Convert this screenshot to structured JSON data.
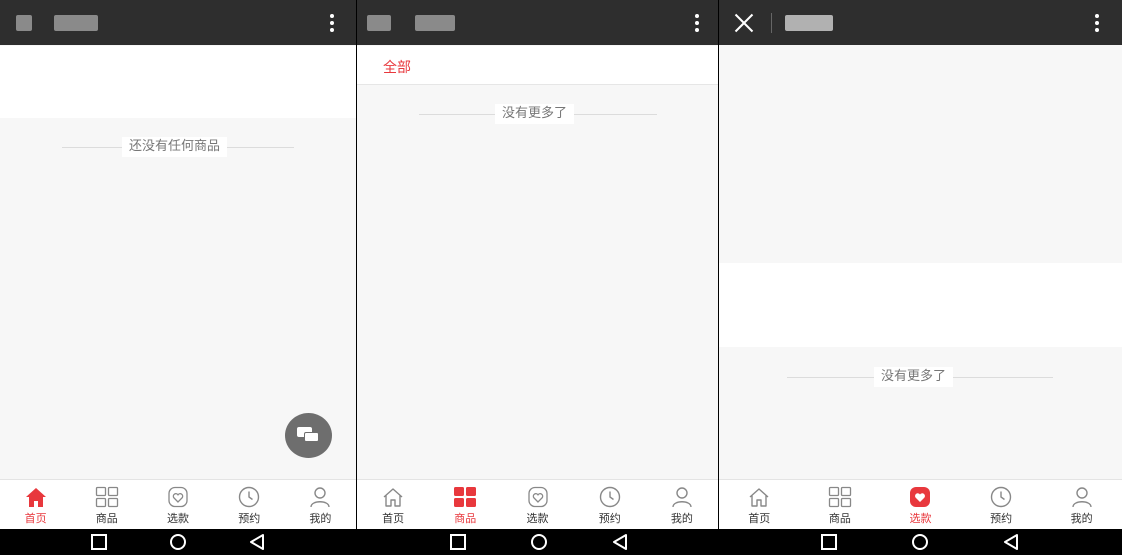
{
  "colors": {
    "accent": "#e8383d",
    "topbar": "#2e2e2e",
    "icon_gray": "#888888"
  },
  "screen1": {
    "empty_text": "还没有任何商品",
    "fab_icon": "chat-bubbles-icon",
    "active_tab": 0
  },
  "screen2": {
    "filter_tab": "全部",
    "end_text": "没有更多了",
    "active_tab": 1
  },
  "screen3": {
    "end_text": "没有更多了",
    "active_tab": 2
  },
  "tabs": [
    {
      "label": "首页",
      "icon": "home-icon"
    },
    {
      "label": "商品",
      "icon": "grid-icon"
    },
    {
      "label": "选款",
      "icon": "heart-bag-icon"
    },
    {
      "label": "预约",
      "icon": "clock-icon"
    },
    {
      "label": "我的",
      "icon": "person-icon"
    }
  ],
  "system_nav": [
    {
      "icon": "recent-apps-square-icon"
    },
    {
      "icon": "home-circle-icon"
    },
    {
      "icon": "back-triangle-icon"
    }
  ]
}
